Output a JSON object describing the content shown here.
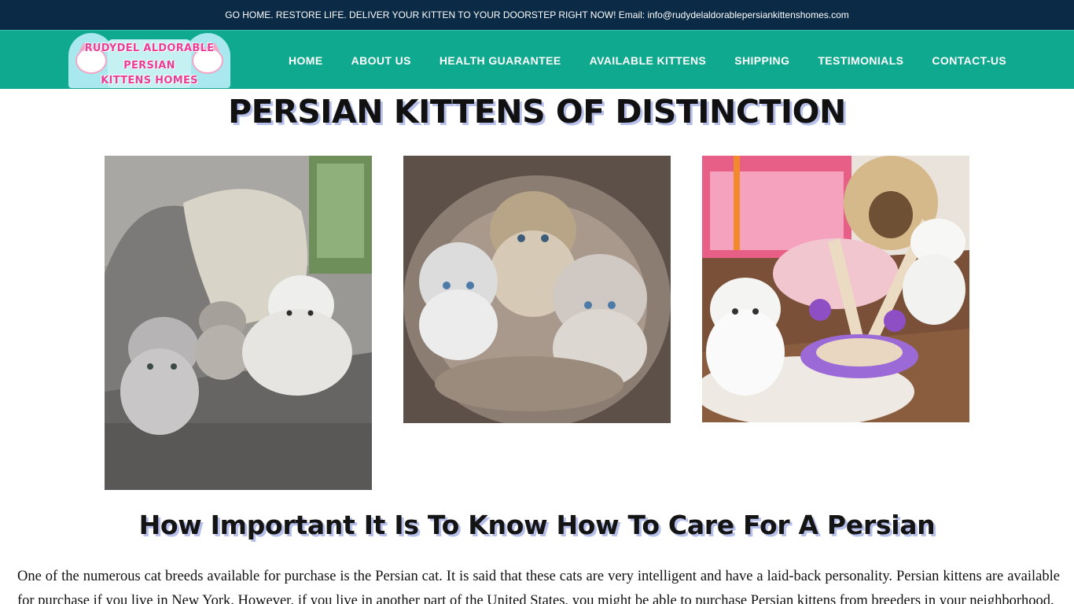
{
  "announcement": {
    "text": "GO HOME. RESTORE LIFE. DELIVER YOUR KITTEN TO YOUR DOORSTEP RIGHT NOW! Email: info@rudydelaldorablepersiankittenshomes.com"
  },
  "logo": {
    "line1": "RUDYDEL ALDORABLE",
    "line2": "PERSIAN",
    "line3": "KITTENS HOMES"
  },
  "nav": {
    "items": [
      {
        "label": "HOME"
      },
      {
        "label": "ABOUT US"
      },
      {
        "label": "HEALTH GUARANTEE"
      },
      {
        "label": "AVAILABLE KITTENS"
      },
      {
        "label": "SHIPPING"
      },
      {
        "label": "TESTIMONIALS"
      },
      {
        "label": "CONTACT-US"
      }
    ]
  },
  "hero": {
    "title": "PERSIAN KITTENS OF DISTINCTION"
  },
  "gallery": {
    "images": [
      {
        "alt": "Persian kittens on a grey sofa"
      },
      {
        "alt": "Three Persian kittens in a cat bed"
      },
      {
        "alt": "White Persian kittens playing with toys"
      }
    ]
  },
  "article": {
    "title": "How Important It Is To Know How To Care For A Persian",
    "paragraph": "One of the numerous cat breeds available for purchase is the Persian cat. It is said that these cats are very intelligent and have a laid-back personality. Persian  kittens are available for purchase if you live in New York. However, if you live in another part of the United States, you might be able to purchase Persian  kittens from breeders in your neighborhood."
  },
  "colors": {
    "topbar": "#0a2a45",
    "navbar": "#0fa98f",
    "title_shadow": "#b7c0ea",
    "logo_text": "#e93d97"
  }
}
